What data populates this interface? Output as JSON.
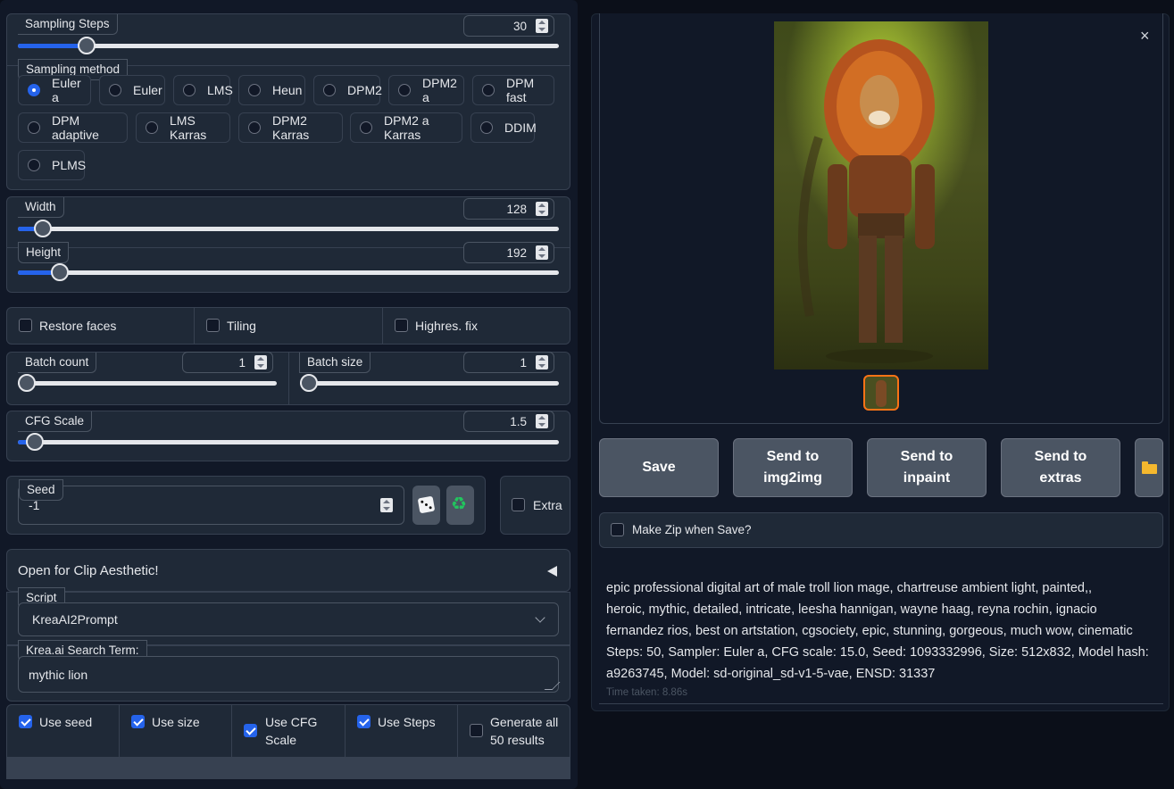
{
  "sampling": {
    "steps": {
      "label": "Sampling Steps",
      "value": "30",
      "fraction": 0.19
    },
    "method": {
      "label": "Sampling method",
      "selected": "Euler a",
      "options": [
        "Euler a",
        "Euler",
        "LMS",
        "Heun",
        "DPM2",
        "DPM2 a",
        "DPM fast",
        "DPM adaptive",
        "LMS Karras",
        "DPM2 Karras",
        "DPM2 a Karras",
        "DDIM",
        "PLMS"
      ]
    }
  },
  "size": {
    "width": {
      "label": "Width",
      "value": "128",
      "fraction": 0.05
    },
    "height": {
      "label": "Height",
      "value": "192",
      "fraction": 0.08
    }
  },
  "options": {
    "restore_faces": {
      "label": "Restore faces",
      "checked": false
    },
    "tiling": {
      "label": "Tiling",
      "checked": false
    },
    "highres": {
      "label": "Highres. fix",
      "checked": false
    }
  },
  "batch": {
    "count": {
      "label": "Batch count",
      "value": "1",
      "fraction": 0.0
    },
    "size": {
      "label": "Batch size",
      "value": "1",
      "fraction": 0.0
    }
  },
  "cfg": {
    "label": "CFG Scale",
    "value": "1.5",
    "fraction": 0.03
  },
  "seed": {
    "label": "Seed",
    "value": "-1",
    "extra_label": "Extra"
  },
  "accordion": {
    "label": "Open for Clip Aesthetic!"
  },
  "script": {
    "label": "Script",
    "value": "KreaAI2Prompt"
  },
  "krea": {
    "label": "Krea.ai Search Term:",
    "value": "mythic lion"
  },
  "use": {
    "seed": {
      "label": "Use seed",
      "checked": true
    },
    "size": {
      "label": "Use size",
      "checked": true
    },
    "cfg_line1": "Use CFG",
    "cfg_line2": "Scale",
    "cfg_checked": true,
    "steps": {
      "label": "Use Steps",
      "checked": true
    },
    "gen_line1": "Generate all",
    "gen_line2": "50 results",
    "gen_checked": false
  },
  "gallery": {
    "close_glyph": "×"
  },
  "actions": {
    "save": "Save",
    "img2img_1": "Send to",
    "img2img_2": "img2img",
    "inpaint_1": "Send to",
    "inpaint_2": "inpaint",
    "extras_1": "Send to",
    "extras_2": "extras",
    "folder_icon": "folder-icon"
  },
  "zip": {
    "label": "Make Zip when Save?",
    "checked": false
  },
  "info": {
    "line1": "epic professional digital art of male troll lion mage, chartreuse ambient light, painted,,",
    "line2": "heroic, mythic, detailed, intricate, leesha hannigan, wayne haag, reyna rochin, ignacio",
    "line3": "fernandez rios, best on artstation, cgsociety, epic, stunning, gorgeous, much wow, cinematic",
    "line4": "Steps: 50, Sampler: Euler a, CFG scale: 15.0, Seed: 1093332996, Size: 512x832, Model hash:",
    "line5": "a9263745, Model: sd-original_sd-v1-5-vae, ENSD: 31337",
    "time": "Time taken: 8.86s"
  },
  "colors": {
    "accent": "#2563eb",
    "panel": "#1f2937",
    "background": "#0b0f19",
    "thumb_border": "#f97316"
  }
}
